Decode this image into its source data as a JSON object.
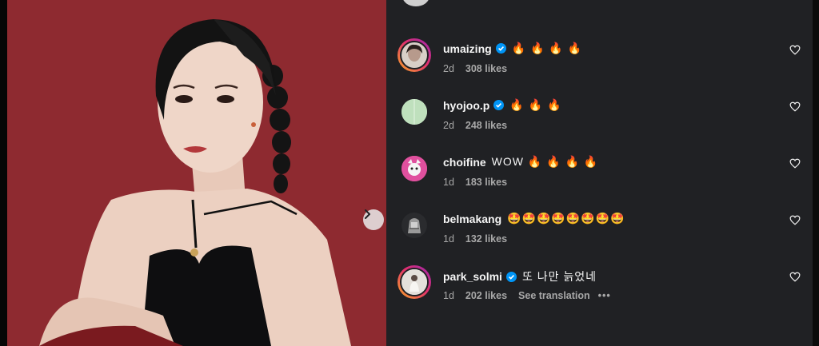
{
  "post": {
    "next_icon": "chevron-right-icon"
  },
  "comments": [
    {
      "username": "umaizing",
      "verified": true,
      "text": "🔥 🔥 🔥 🔥",
      "time": "2d",
      "likes": "308 likes",
      "avatar": "portrait-avatar",
      "story_ring": true
    },
    {
      "username": "hyojoo.p",
      "verified": true,
      "text": "🔥 🔥 🔥",
      "time": "2d",
      "likes": "248 likes",
      "avatar": "mint-avatar",
      "story_ring": false
    },
    {
      "username": "choifine",
      "verified": false,
      "text": "WOW 🔥 🔥 🔥 🔥",
      "time": "1d",
      "likes": "183 likes",
      "avatar": "cartoon-avatar",
      "story_ring": false
    },
    {
      "username": "belmakang",
      "verified": false,
      "text": "🤩🤩🤩🤩🤩🤩🤩🤩",
      "time": "1d",
      "likes": "132 likes",
      "avatar": "sculpture-avatar",
      "story_ring": false
    },
    {
      "username": "park_solmi",
      "verified": true,
      "text": "또 나만 늙었네",
      "time": "1d",
      "likes": "202 likes",
      "see_translation": "See translation",
      "more": "•••",
      "avatar": "photo-avatar",
      "story_ring": true
    }
  ],
  "colors": {
    "panel": "#202124",
    "photo_bg": "#8e2a30",
    "verified": "#0095f6"
  }
}
